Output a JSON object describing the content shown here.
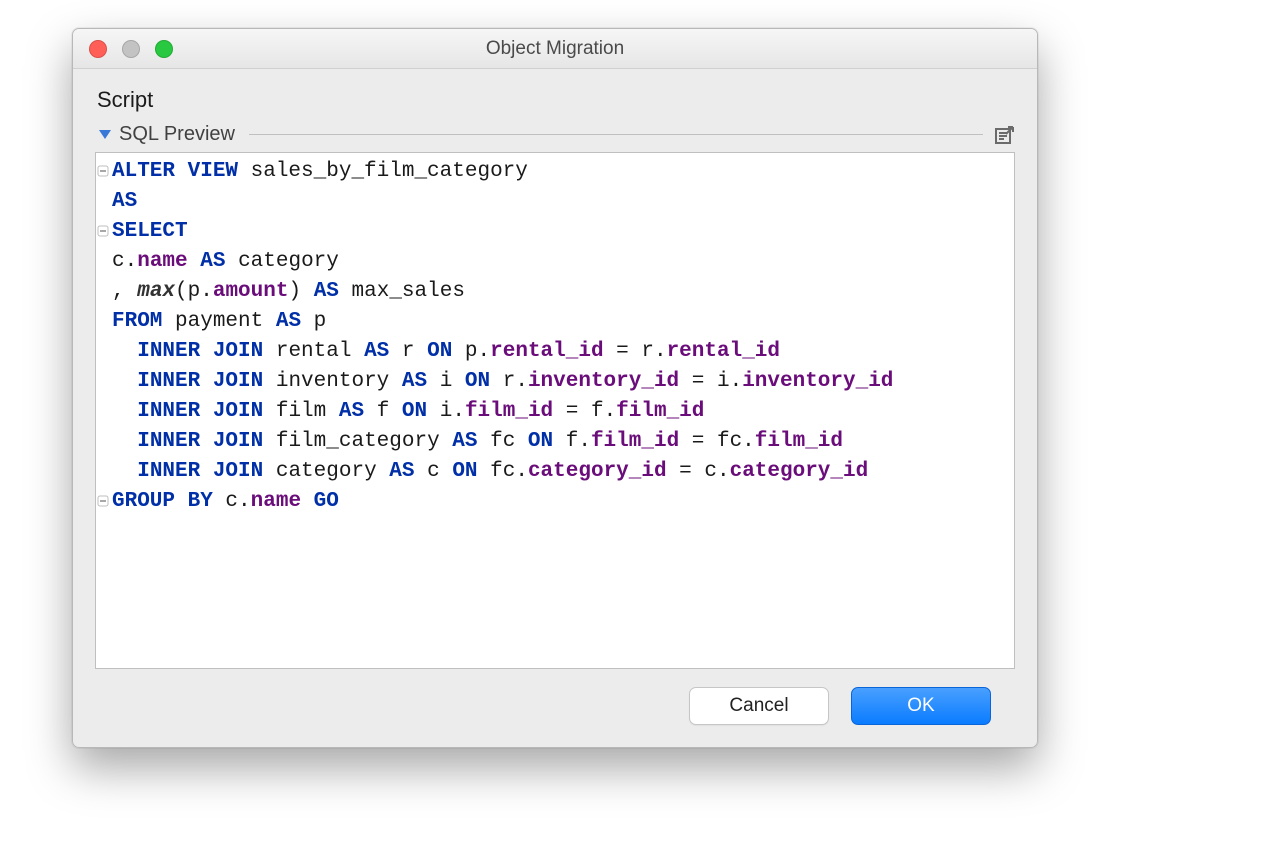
{
  "window": {
    "title": "Object Migration"
  },
  "header": {
    "script_label": "Script",
    "preview_label": "SQL Preview",
    "edit_icon_name": "edit-in-external-icon"
  },
  "buttons": {
    "cancel": "Cancel",
    "ok": "OK"
  },
  "code": {
    "lines": [
      [
        {
          "t": "ALTER VIEW ",
          "c": "kw"
        },
        {
          "t": "sales_by_film_category"
        }
      ],
      [
        {
          "t": "AS",
          "c": "kw"
        }
      ],
      [
        {
          "t": "SELECT",
          "c": "kw"
        }
      ],
      [
        {
          "t": "c."
        },
        {
          "t": "name",
          "c": "fld"
        },
        {
          "t": " "
        },
        {
          "t": "AS",
          "c": "kw"
        },
        {
          "t": " category"
        }
      ],
      [
        {
          "t": ", "
        },
        {
          "t": "max",
          "c": "fn"
        },
        {
          "t": "(p."
        },
        {
          "t": "amount",
          "c": "fld"
        },
        {
          "t": ") "
        },
        {
          "t": "AS",
          "c": "kw"
        },
        {
          "t": " max_sales"
        }
      ],
      [
        {
          "t": "FROM",
          "c": "kw"
        },
        {
          "t": " payment "
        },
        {
          "t": "AS",
          "c": "kw"
        },
        {
          "t": " p"
        }
      ],
      [
        {
          "t": "  "
        },
        {
          "t": "INNER JOIN",
          "c": "kw"
        },
        {
          "t": " rental "
        },
        {
          "t": "AS",
          "c": "kw"
        },
        {
          "t": " r "
        },
        {
          "t": "ON",
          "c": "kw"
        },
        {
          "t": " p."
        },
        {
          "t": "rental_id",
          "c": "fld"
        },
        {
          "t": " = r."
        },
        {
          "t": "rental_id",
          "c": "fld"
        }
      ],
      [
        {
          "t": "  "
        },
        {
          "t": "INNER JOIN",
          "c": "kw"
        },
        {
          "t": " inventory "
        },
        {
          "t": "AS",
          "c": "kw"
        },
        {
          "t": " i "
        },
        {
          "t": "ON",
          "c": "kw"
        },
        {
          "t": " r."
        },
        {
          "t": "inventory_id",
          "c": "fld"
        },
        {
          "t": " = i."
        },
        {
          "t": "inventory_id",
          "c": "fld"
        }
      ],
      [
        {
          "t": "  "
        },
        {
          "t": "INNER JOIN",
          "c": "kw"
        },
        {
          "t": " film "
        },
        {
          "t": "AS",
          "c": "kw"
        },
        {
          "t": " f "
        },
        {
          "t": "ON",
          "c": "kw"
        },
        {
          "t": " i."
        },
        {
          "t": "film_id",
          "c": "fld"
        },
        {
          "t": " = f."
        },
        {
          "t": "film_id",
          "c": "fld"
        }
      ],
      [
        {
          "t": "  "
        },
        {
          "t": "INNER JOIN",
          "c": "kw"
        },
        {
          "t": " film_category "
        },
        {
          "t": "AS",
          "c": "kw"
        },
        {
          "t": " fc "
        },
        {
          "t": "ON",
          "c": "kw"
        },
        {
          "t": " f."
        },
        {
          "t": "film_id",
          "c": "fld"
        },
        {
          "t": " = fc."
        },
        {
          "t": "film_id",
          "c": "fld"
        }
      ],
      [
        {
          "t": "  "
        },
        {
          "t": "INNER JOIN",
          "c": "kw"
        },
        {
          "t": " category "
        },
        {
          "t": "AS",
          "c": "kw"
        },
        {
          "t": " c "
        },
        {
          "t": "ON",
          "c": "kw"
        },
        {
          "t": " fc."
        },
        {
          "t": "category_id",
          "c": "fld"
        },
        {
          "t": " = c."
        },
        {
          "t": "category_id",
          "c": "fld"
        }
      ],
      [
        {
          "t": "GROUP BY",
          "c": "kw"
        },
        {
          "t": " c."
        },
        {
          "t": "name",
          "c": "fld"
        },
        {
          "t": " "
        },
        {
          "t": "GO",
          "c": "kw"
        }
      ]
    ],
    "fold_rows": [
      0,
      2,
      11
    ]
  }
}
